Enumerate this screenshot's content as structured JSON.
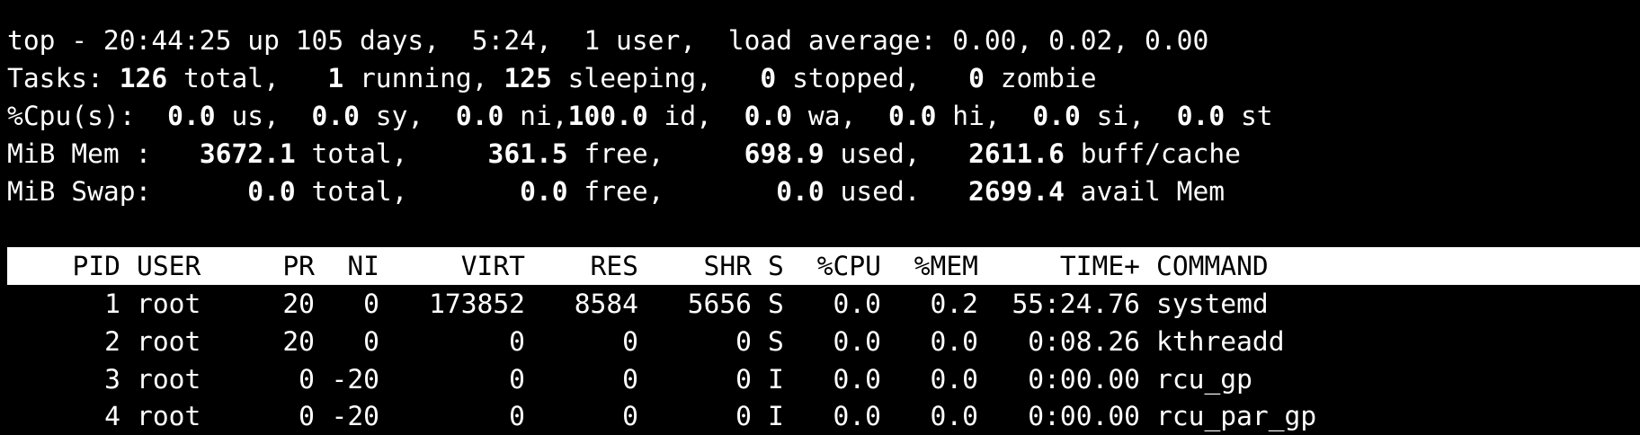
{
  "summary": {
    "uptime_line": "top - 20:44:25 up 105 days,  5:24,  1 user,  load average: 0.00, 0.02, 0.00",
    "tasks": {
      "label": "Tasks: ",
      "total": "126",
      "total_label": " total,   ",
      "running": "1",
      "running_label": " running, ",
      "sleeping": "125",
      "sleeping_label": " sleeping,   ",
      "stopped": "0",
      "stopped_label": " stopped,   ",
      "zombie": "0",
      "zombie_label": " zombie"
    },
    "cpu": {
      "label": "%Cpu(s):  ",
      "us": "0.0",
      "us_label": " us,  ",
      "sy": "0.0",
      "sy_label": " sy,  ",
      "ni": "0.0",
      "ni_label": " ni,",
      "id": "100.0",
      "id_label": " id,  ",
      "wa": "0.0",
      "wa_label": " wa,  ",
      "hi": "0.0",
      "hi_label": " hi,  ",
      "si": "0.0",
      "si_label": " si,  ",
      "st": "0.0",
      "st_label": " st"
    },
    "mem": {
      "label": "MiB Mem :   ",
      "total": "3672.1",
      "total_label": " total,     ",
      "free": "361.5",
      "free_label": " free,     ",
      "used": "698.9",
      "used_label": " used,   ",
      "buff_cache": "2611.6",
      "buff_cache_label": " buff/cache"
    },
    "swap": {
      "label": "MiB Swap:      ",
      "total": "0.0",
      "total_label": " total,       ",
      "free": "0.0",
      "free_label": " free,       ",
      "used": "0.0",
      "used_label": " used.   ",
      "avail": "2699.4",
      "avail_label": " avail Mem"
    }
  },
  "columns": {
    "pid": "PID",
    "user": "USER",
    "pr": "PR",
    "ni": "NI",
    "virt": "VIRT",
    "res": "RES",
    "shr": "SHR",
    "s": "S",
    "cpu": "%CPU",
    "mem": "%MEM",
    "time": "TIME+",
    "command": "COMMAND"
  },
  "processes": [
    {
      "pid": "1",
      "user": "root",
      "pr": "20",
      "ni": "0",
      "virt": "173852",
      "res": "8584",
      "shr": "5656",
      "s": "S",
      "cpu": "0.0",
      "mem": "0.2",
      "time": "55:24.76",
      "command": "systemd"
    },
    {
      "pid": "2",
      "user": "root",
      "pr": "20",
      "ni": "0",
      "virt": "0",
      "res": "0",
      "shr": "0",
      "s": "S",
      "cpu": "0.0",
      "mem": "0.0",
      "time": "0:08.26",
      "command": "kthreadd"
    },
    {
      "pid": "3",
      "user": "root",
      "pr": "0",
      "ni": "-20",
      "virt": "0",
      "res": "0",
      "shr": "0",
      "s": "I",
      "cpu": "0.0",
      "mem": "0.0",
      "time": "0:00.00",
      "command": "rcu_gp"
    },
    {
      "pid": "4",
      "user": "root",
      "pr": "0",
      "ni": "-20",
      "virt": "0",
      "res": "0",
      "shr": "0",
      "s": "I",
      "cpu": "0.0",
      "mem": "0.0",
      "time": "0:00.00",
      "command": "rcu_par_gp"
    }
  ],
  "colors": {
    "background": "#000000",
    "foreground": "#ffffff",
    "header_bg": "#ffffff",
    "header_fg": "#000000"
  }
}
